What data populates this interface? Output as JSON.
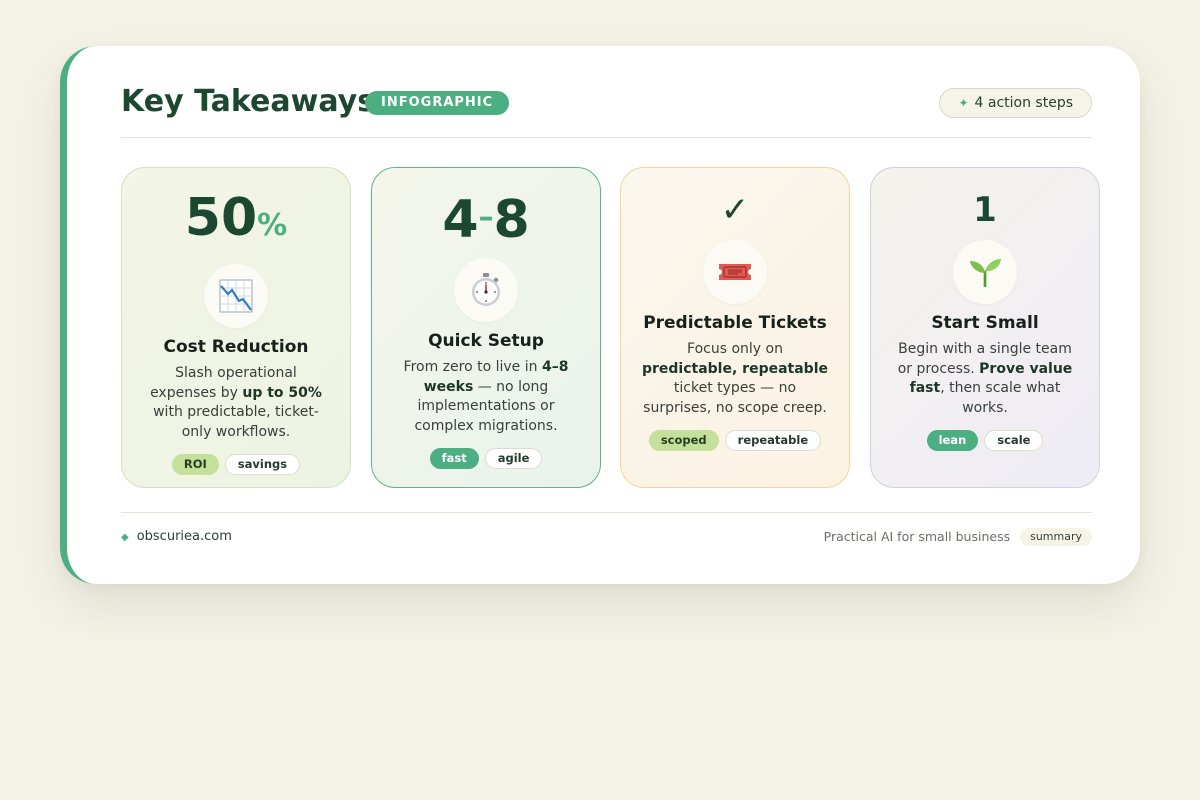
{
  "header": {
    "title": "Key Takeaways",
    "badge": "INFOGRAPHIC",
    "steps_label": "4 action steps",
    "steps_icon": "sparkle-icon"
  },
  "cards": [
    {
      "stat": "50",
      "stat_suffix": "%",
      "icon": "chart-down-icon",
      "title": "Cost Reduction",
      "desc": [
        "Slash operational expenses by ",
        "up to 50%",
        " with predictable, ticket-only workflows."
      ],
      "tags": [
        "ROI",
        "savings"
      ]
    },
    {
      "stat_a": "4",
      "stat_dash": "–",
      "stat_b": "8",
      "icon": "stopwatch-icon",
      "title": "Quick Setup",
      "desc": [
        "From zero to live in ",
        "4–8 weeks",
        " — no long implementations or complex migrations."
      ],
      "tags": [
        "fast",
        "agile"
      ]
    },
    {
      "stat": "✓",
      "icon": "ticket-icon",
      "title": "Predictable Tickets",
      "desc": [
        "Focus only on ",
        "predictable, repeatable",
        " ticket types — no surprises, no scope creep."
      ],
      "tags": [
        "scoped",
        "repeatable"
      ]
    },
    {
      "stat": "1",
      "icon": "seedling-icon",
      "title": "Start Small",
      "desc": [
        "Begin with a single team or process. ",
        "Prove value fast",
        ", then scale what works."
      ],
      "tags": [
        "lean",
        "scale"
      ]
    }
  ],
  "footer": {
    "site": "obscuriea.com",
    "tagline": "Practical AI for small business",
    "chip": "summary"
  },
  "colors": {
    "accent": "#4caf82",
    "title": "#1c4730",
    "background": "#f4f1e6"
  }
}
